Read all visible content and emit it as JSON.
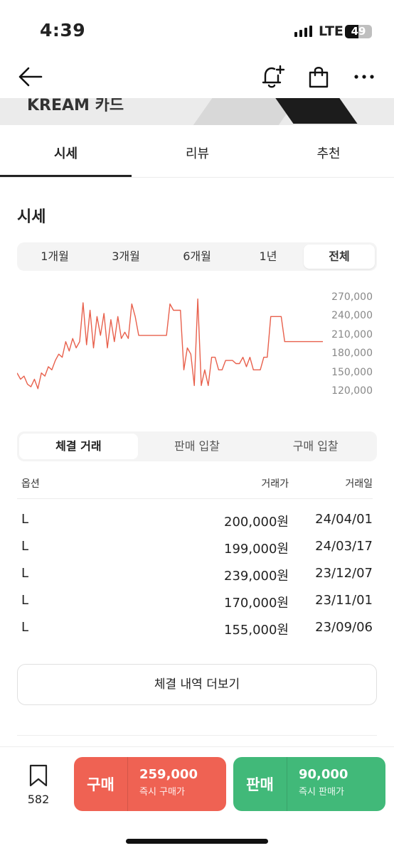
{
  "status": {
    "time": "4:39",
    "network": "LTE",
    "battery": "49",
    "battery_level": 0.49
  },
  "banner": {
    "text": "KREAM 카드"
  },
  "tabs": [
    {
      "label": "시세",
      "active": true
    },
    {
      "label": "리뷰",
      "active": false
    },
    {
      "label": "추천",
      "active": false
    }
  ],
  "section": {
    "title": "시세"
  },
  "periods": [
    {
      "label": "1개월",
      "active": false
    },
    {
      "label": "3개월",
      "active": false
    },
    {
      "label": "6개월",
      "active": false
    },
    {
      "label": "1년",
      "active": false
    },
    {
      "label": "전체",
      "active": true
    }
  ],
  "chart_data": {
    "type": "line",
    "color": "#e8604c",
    "ylim": [
      110000,
      280000
    ],
    "yticks": [
      "270,000",
      "240,000",
      "210,000",
      "180,000",
      "150,000",
      "120,000"
    ],
    "ytick_values": [
      270000,
      240000,
      210000,
      180000,
      150000,
      120000
    ],
    "values": [
      150000,
      140000,
      145000,
      132000,
      128000,
      140000,
      125000,
      150000,
      145000,
      160000,
      155000,
      170000,
      180000,
      175000,
      200000,
      185000,
      205000,
      190000,
      200000,
      262000,
      195000,
      250000,
      190000,
      240000,
      210000,
      245000,
      190000,
      235000,
      200000,
      240000,
      205000,
      215000,
      205000,
      260000,
      240000,
      210000,
      210000,
      210000,
      210000,
      210000,
      210000,
      210000,
      210000,
      210000,
      260000,
      250000,
      250000,
      250000,
      155000,
      190000,
      180000,
      130000,
      268000,
      130000,
      155000,
      130000,
      175000,
      175000,
      155000,
      155000,
      170000,
      170000,
      170000,
      165000,
      165000,
      175000,
      160000,
      175000,
      155000,
      155000,
      155000,
      175000,
      175000,
      240000,
      240000,
      240000,
      240000,
      200000,
      200000,
      200000,
      200000,
      200000,
      200000,
      200000,
      200000,
      200000,
      200000,
      200000,
      200000
    ]
  },
  "trade_tabs": [
    {
      "label": "체결 거래",
      "active": true
    },
    {
      "label": "판매 입찰",
      "active": false
    },
    {
      "label": "구매 입찰",
      "active": false
    }
  ],
  "table": {
    "headers": {
      "option": "옵션",
      "price": "거래가",
      "date": "거래일"
    },
    "rows": [
      {
        "option": "L",
        "price": "200,000원",
        "date": "24/04/01"
      },
      {
        "option": "L",
        "price": "199,000원",
        "date": "24/03/17"
      },
      {
        "option": "L",
        "price": "239,000원",
        "date": "23/12/07"
      },
      {
        "option": "L",
        "price": "170,000원",
        "date": "23/11/01"
      },
      {
        "option": "L",
        "price": "155,000원",
        "date": "23/09/06"
      }
    ]
  },
  "more_button": "체결 내역 더보기",
  "bottom": {
    "wish_count": "582",
    "buy": {
      "label": "구매",
      "price": "259,000",
      "sub": "즉시 구매가",
      "color": "#ef6253"
    },
    "sell": {
      "label": "판매",
      "price": "90,000",
      "sub": "즉시 판매가",
      "color": "#41b979"
    }
  }
}
